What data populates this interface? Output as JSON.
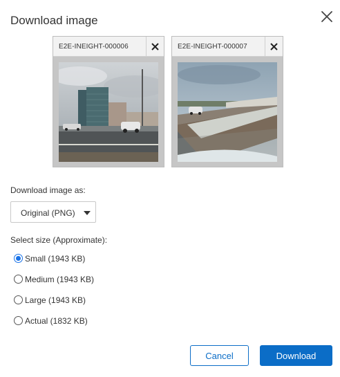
{
  "dialog": {
    "title": "Download image"
  },
  "images": [
    {
      "name": "E2E-INEIGHT-000006"
    },
    {
      "name": "E2E-INEIGHT-000007"
    }
  ],
  "format": {
    "label": "Download image as:",
    "selected": "Original (PNG)"
  },
  "size": {
    "label": "Select size (Approximate):",
    "options": [
      {
        "label": "Small (1943 KB)",
        "checked": true
      },
      {
        "label": "Medium (1943 KB)",
        "checked": false
      },
      {
        "label": "Large (1943 KB)",
        "checked": false
      },
      {
        "label": "Actual (1832 KB)",
        "checked": false
      }
    ]
  },
  "buttons": {
    "cancel": "Cancel",
    "download": "Download"
  },
  "colors": {
    "accent": "#0b6dc7",
    "radio_checked": "#1a73e8"
  },
  "icons": {
    "close": "close-icon",
    "remove": "remove-x-icon",
    "dropdown": "caret-down-icon"
  }
}
